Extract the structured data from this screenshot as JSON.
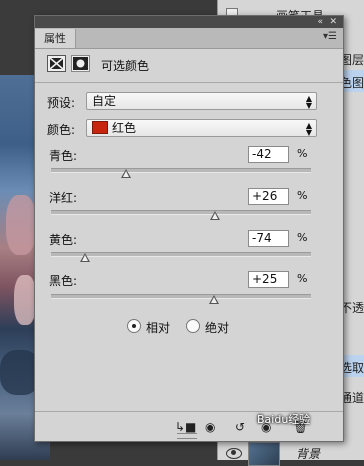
{
  "layers_panel": {
    "rows": [
      "画笔工具",
      "图层",
      "色图层",
      "不透",
      "选取",
      "通道",
      "背景"
    ]
  },
  "dialog": {
    "tab_label": "属性",
    "adjustment_title": "可选颜色",
    "preset": {
      "label": "预设:",
      "value": "自定"
    },
    "color": {
      "label": "颜色:",
      "value": "红色",
      "swatch_color": "#c8250e"
    },
    "sliders": [
      {
        "label": "青色:",
        "value": "-42",
        "unit": "%",
        "amount": -42
      },
      {
        "label": "洋红:",
        "value": "+26",
        "unit": "%",
        "amount": 26
      },
      {
        "label": "黄色:",
        "value": "-74",
        "unit": "%",
        "amount": -74
      },
      {
        "label": "黑色:",
        "value": "+25",
        "unit": "%",
        "amount": 25
      }
    ],
    "method": {
      "relative": "相对",
      "absolute": "绝对",
      "selected": "relative"
    }
  },
  "watermark": "Baidu经验"
}
